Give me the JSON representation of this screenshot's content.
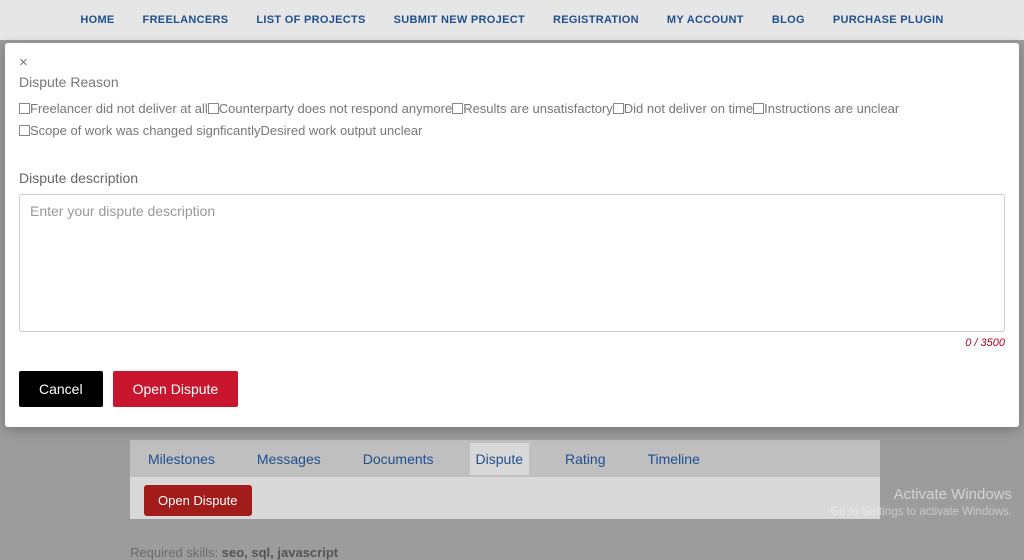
{
  "nav": {
    "items": [
      "HOME",
      "FREELANCERS",
      "LIST OF PROJECTS",
      "SUBMIT NEW PROJECT",
      "REGISTRATION",
      "MY ACCOUNT",
      "BLOG",
      "PURCHASE PLUGIN"
    ]
  },
  "modal": {
    "close_glyph": "×",
    "title": "Dispute Reason",
    "reasons": [
      "Freelancer did not deliver at all",
      "Counterparty does not respond anymore",
      "Results are unsatisfactory",
      "Did not deliver on time",
      "Instructions are unclear",
      "Scope of work was changed signficantly",
      "Desired work output unclear"
    ],
    "desc_label": "Dispute description",
    "desc_placeholder": "Enter your dispute description",
    "counter": "0 / 3500",
    "cancel_label": "Cancel",
    "submit_label": "Open Dispute"
  },
  "tabs": {
    "items": [
      "Milestones",
      "Messages",
      "Documents",
      "Dispute",
      "Rating",
      "Timeline"
    ],
    "active_index": 3,
    "open_dispute_label": "Open Dispute"
  },
  "skills": {
    "prefix": "Required skills: ",
    "list": "seo, sql, javascript"
  },
  "watermark": {
    "line1": "Activate Windows",
    "line2": "Go to Settings to activate Windows."
  }
}
